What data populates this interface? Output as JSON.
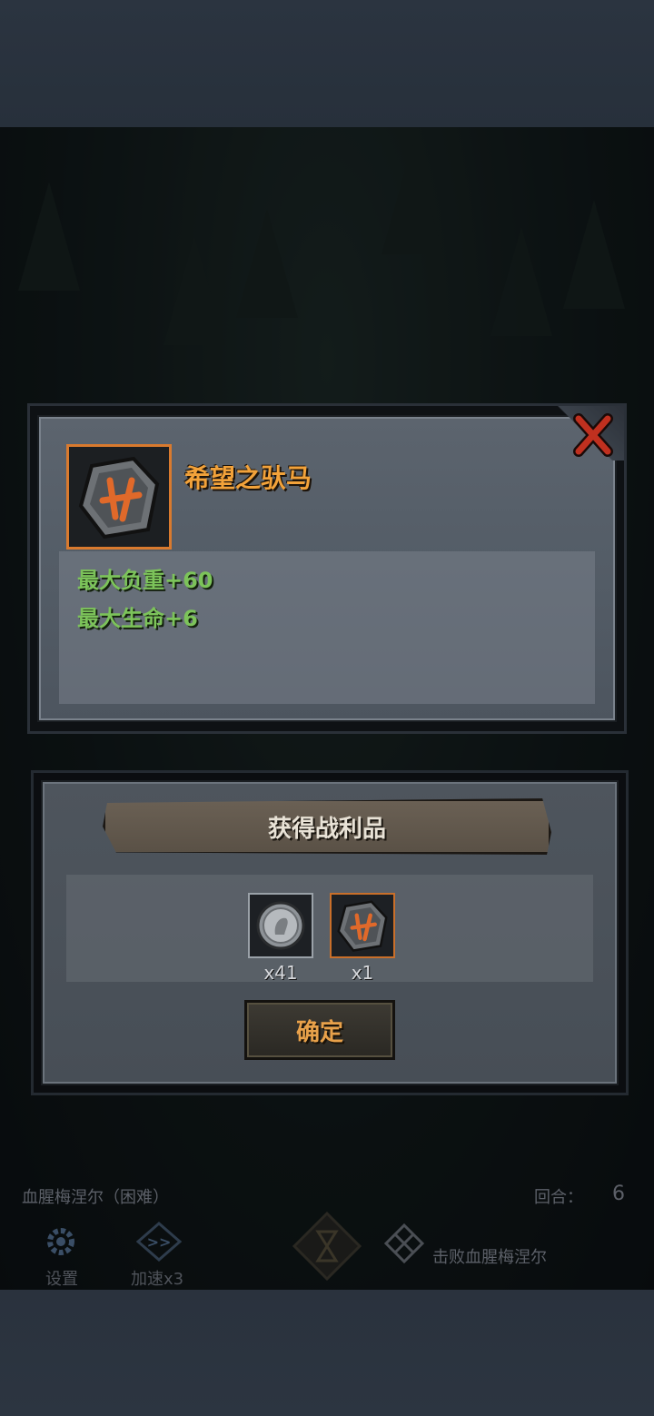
{
  "item": {
    "name": "希望之驮马",
    "stats": [
      "最大负重+60",
      "最大生命+6"
    ]
  },
  "loot": {
    "title": "获得战利品",
    "items": [
      {
        "icon": "silver-coin-icon",
        "quantity": "x41"
      },
      {
        "icon": "rune-stone-icon",
        "quantity": "x1"
      }
    ],
    "confirm_label": "确定"
  },
  "hud": {
    "stage_name": "血腥梅涅尔（困难）",
    "round_label": "回合：",
    "round_value": "6",
    "settings_label": "设置",
    "speed_label": "加速x3",
    "objective": "击败血腥梅涅尔"
  },
  "colors": {
    "accent_orange": "#f2a23a",
    "stat_green": "#7cc35a",
    "close_red": "#c0301f"
  }
}
